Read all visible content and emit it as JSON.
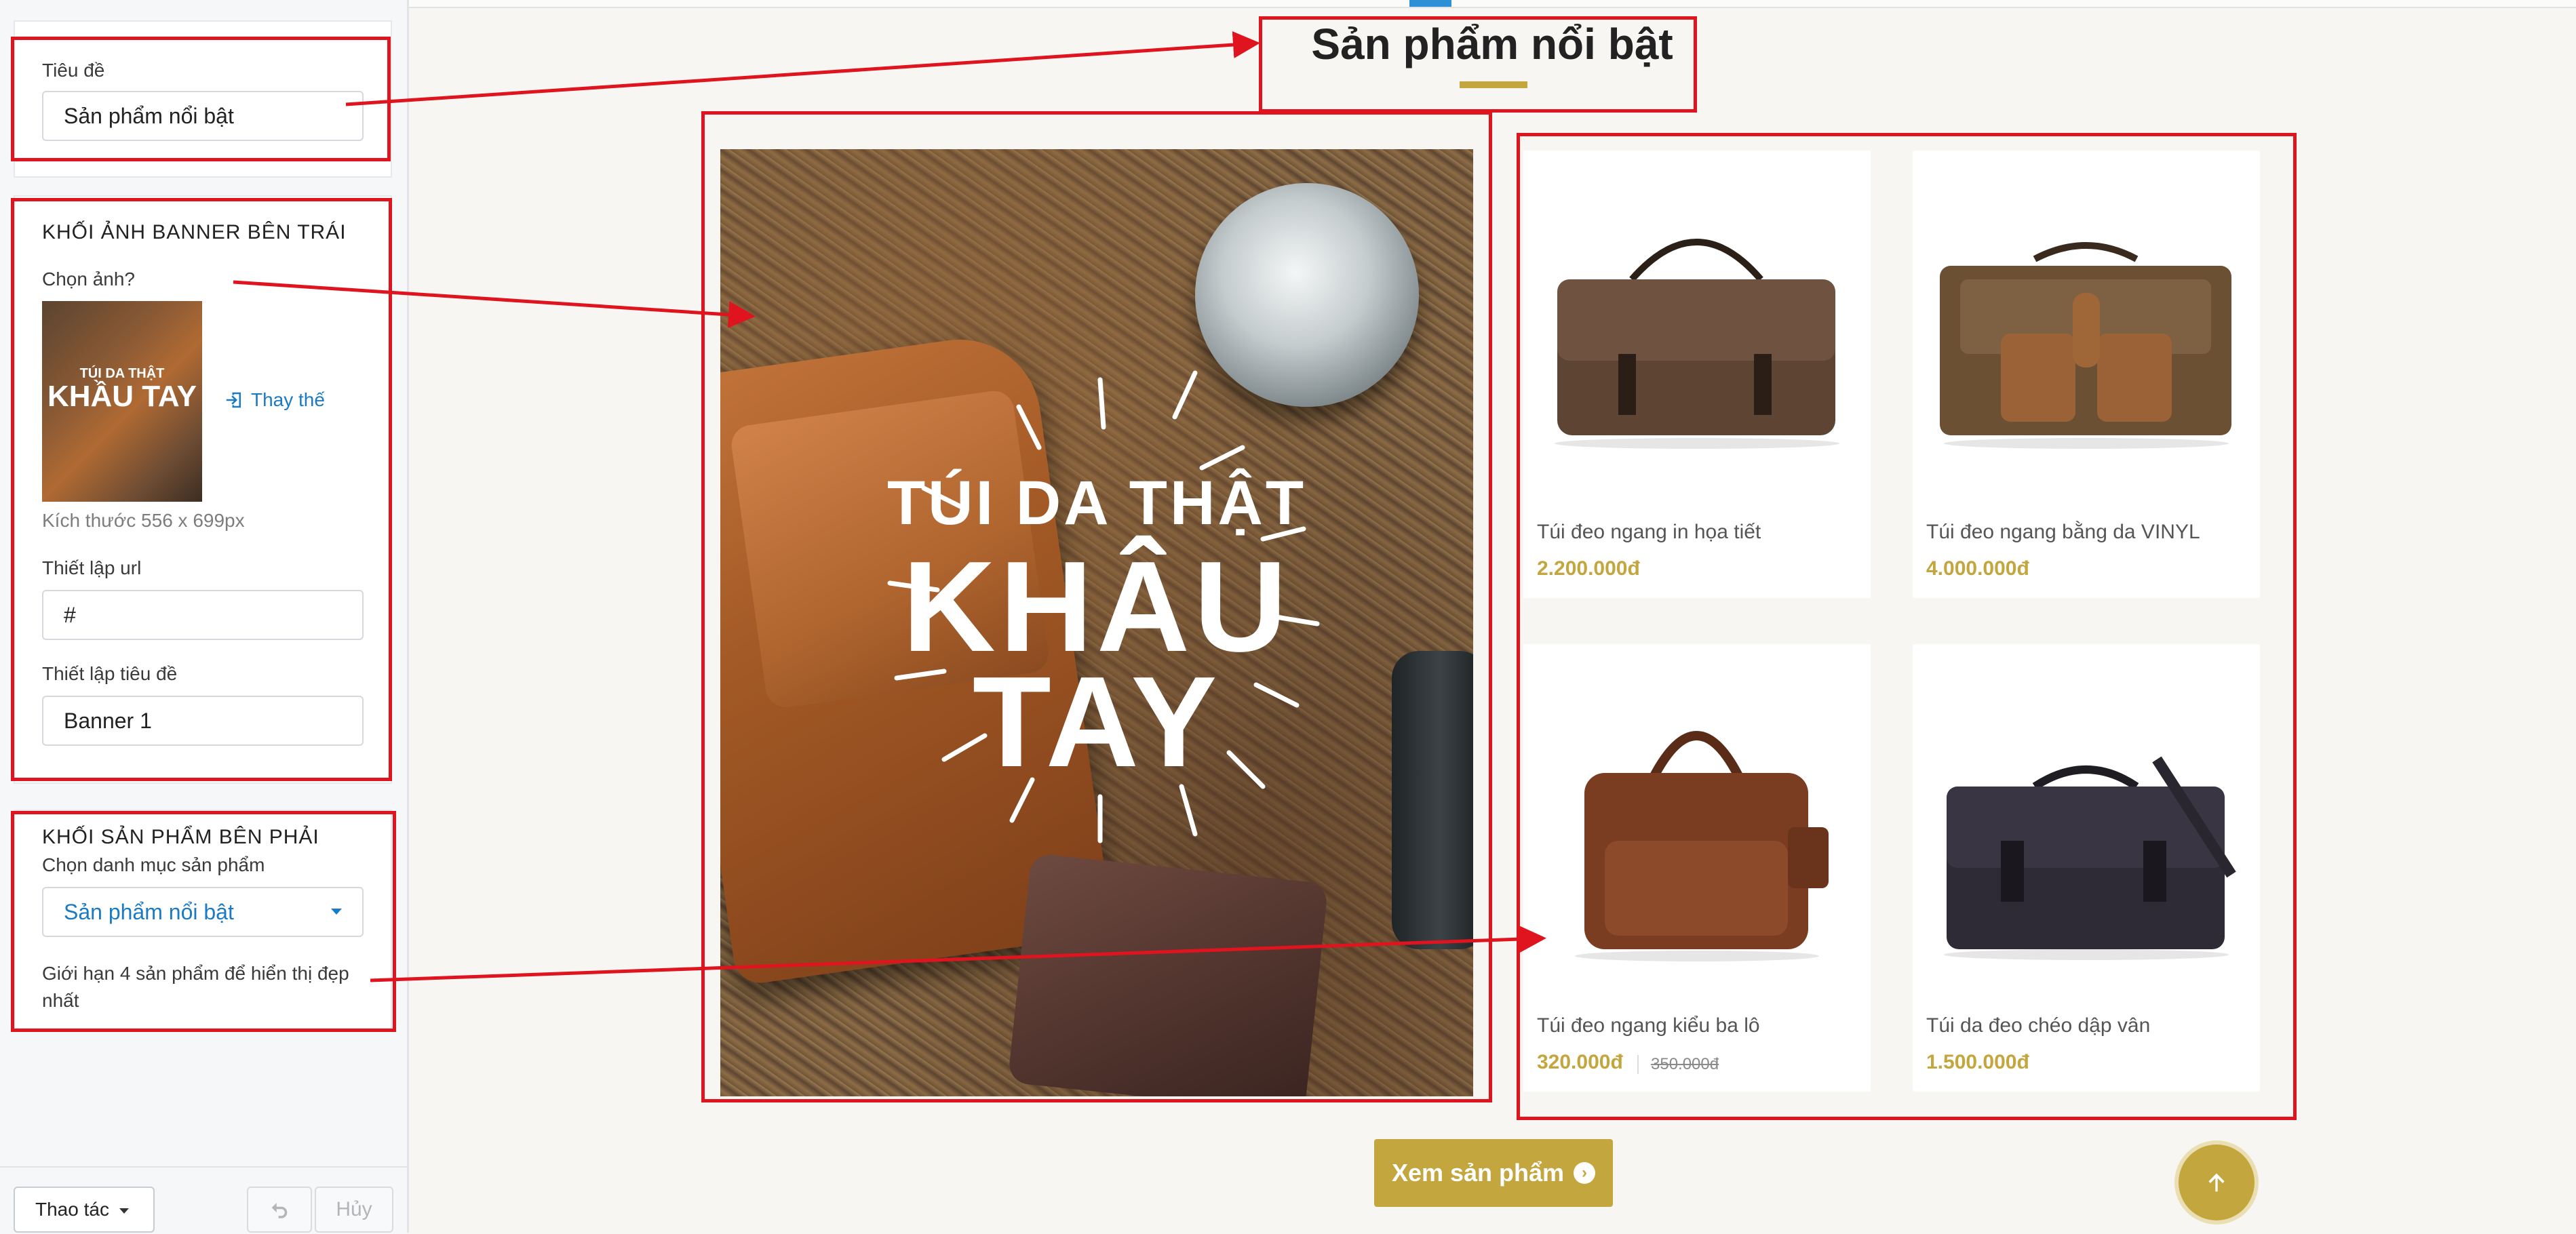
{
  "sidebar": {
    "title_field": {
      "label": "Tiêu đề",
      "value": "Sản phẩm nổi bật"
    },
    "banner_block": {
      "section_title": "KHỐI ẢNH BANNER BÊN TRÁI",
      "choose_image_label": "Chọn ảnh?",
      "thumb_line1": "TÚI DA THẬT",
      "thumb_line2": "KHẦU TAY",
      "replace_label": "Thay thế",
      "size_note": "Kích thước 556 x 699px",
      "url_label": "Thiết lập url",
      "url_value": "#",
      "title_label": "Thiết lập tiêu đề",
      "title_value": "Banner 1"
    },
    "product_block": {
      "section_title": "KHỐI SẢN PHẨM BÊN PHẢI",
      "category_label": "Chọn danh mục sản phẩm",
      "category_value": "Sản phẩm nổi bật",
      "limit_note": "Giới hạn 4 sản phẩm để hiển thị đẹp nhất"
    },
    "bottom": {
      "actions_label": "Thao tác",
      "cancel_label": "Hủy"
    }
  },
  "preview": {
    "heading": "Sản phẩm nổi bật",
    "banner": {
      "line1": "TÚI DA THẬT",
      "line2": "KHÂU",
      "line3": "TAY"
    },
    "products": [
      {
        "name": "Túi đeo ngang in họa tiết",
        "price": "2.200.000đ",
        "old_price": ""
      },
      {
        "name": "Túi đeo ngang bằng da VINYL",
        "price": "4.000.000đ",
        "old_price": ""
      },
      {
        "name": "Túi đeo ngang kiểu ba lô",
        "price": "320.000đ",
        "old_price": "350.000đ"
      },
      {
        "name": "Túi da đeo chéo dập vân",
        "price": "1.500.000đ",
        "old_price": ""
      }
    ],
    "view_button": "Xem sản phẩm"
  },
  "colors": {
    "accent_gold": "#c4a63e",
    "annotation_red": "#e0141e",
    "link_blue": "#1a7bc4"
  },
  "icons": [
    "replace-icon",
    "caret-down-icon",
    "undo-icon",
    "arrow-right-circle-icon",
    "arrow-up-icon"
  ]
}
